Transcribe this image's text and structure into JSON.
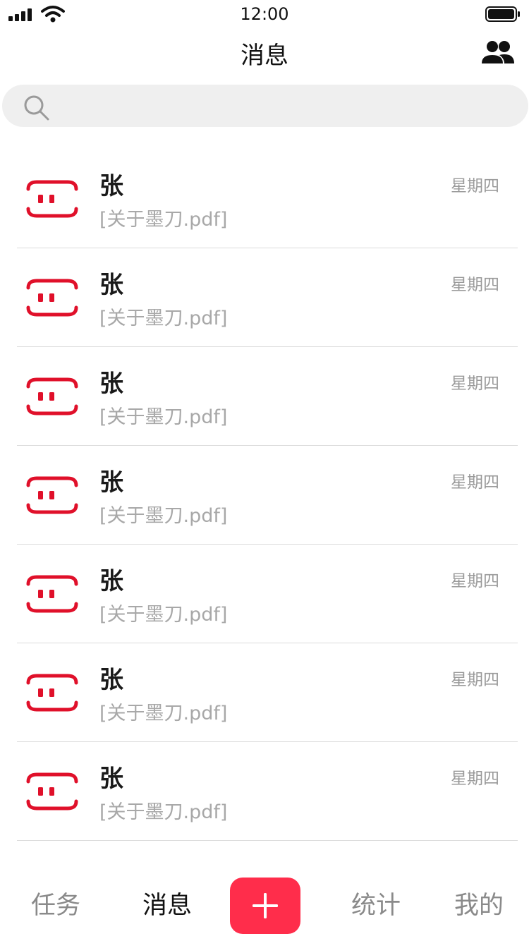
{
  "status_bar": {
    "time": "12:00"
  },
  "header": {
    "title": "消息",
    "contacts_icon": "contacts-icon"
  },
  "search": {
    "icon": "search-icon",
    "placeholder": ""
  },
  "messages": [
    {
      "name": "张",
      "preview": "[关于墨刀.pdf]",
      "date": "星期四",
      "avatar_icon": "mockplus-logo-icon"
    },
    {
      "name": "张",
      "preview": "[关于墨刀.pdf]",
      "date": "星期四",
      "avatar_icon": "mockplus-logo-icon"
    },
    {
      "name": "张",
      "preview": "[关于墨刀.pdf]",
      "date": "星期四",
      "avatar_icon": "mockplus-logo-icon"
    },
    {
      "name": "张",
      "preview": "[关于墨刀.pdf]",
      "date": "星期四",
      "avatar_icon": "mockplus-logo-icon"
    },
    {
      "name": "张",
      "preview": "[关于墨刀.pdf]",
      "date": "星期四",
      "avatar_icon": "mockplus-logo-icon"
    },
    {
      "name": "张",
      "preview": "[关于墨刀.pdf]",
      "date": "星期四",
      "avatar_icon": "mockplus-logo-icon"
    },
    {
      "name": "张",
      "preview": "[关于墨刀.pdf]",
      "date": "星期四",
      "avatar_icon": "mockplus-logo-icon"
    }
  ],
  "tab_bar": {
    "tabs": [
      {
        "label": "任务",
        "active": false
      },
      {
        "label": "消息",
        "active": true
      },
      {
        "label": "统计",
        "active": false
      },
      {
        "label": "我的",
        "active": false
      }
    ],
    "add_icon": "plus-icon"
  },
  "colors": {
    "accent": "#ff2d4b",
    "logo_red": "#e0102a",
    "muted_text": "#a8a8a8",
    "divider": "#dcdcdc",
    "search_bg": "#efefef"
  }
}
